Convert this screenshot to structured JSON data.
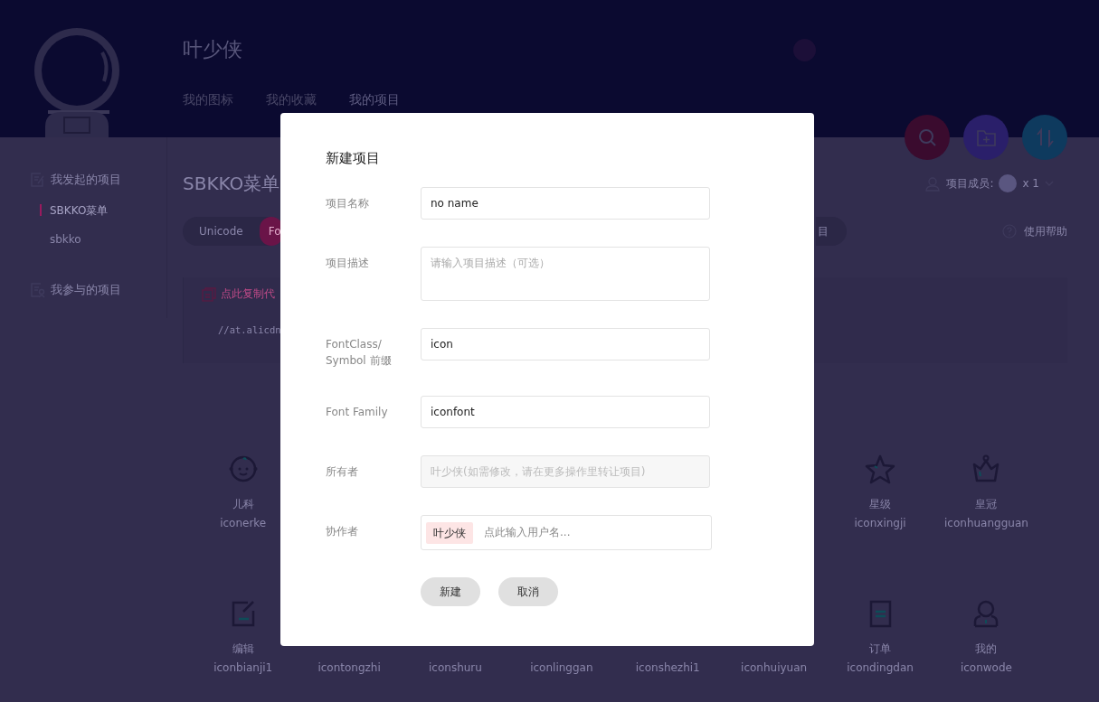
{
  "header": {
    "user_name": "叶少侠",
    "nav": [
      {
        "label": "我的图标",
        "selected": false
      },
      {
        "label": "我的收藏",
        "selected": false
      },
      {
        "label": "我的项目",
        "selected": true
      }
    ]
  },
  "sidebar": {
    "groups": [
      {
        "label": "我发起的项目",
        "items": [
          {
            "label": "SBKKO菜单",
            "selected": true
          },
          {
            "label": "sbkko",
            "selected": false
          }
        ]
      },
      {
        "label": "我参与的项目"
      }
    ]
  },
  "project": {
    "title": "SBKKO菜单",
    "members_label": "项目成员:",
    "members_count": "x 1",
    "help": "使用帮助",
    "tabs": [
      {
        "label": "Unicode",
        "selected": false
      },
      {
        "label": "Fo",
        "selected": true
      }
    ],
    "tab_right": {
      "label": "目",
      "selected": false
    },
    "copy_link": "点此复制代",
    "code": "//at.alicdn",
    "icon_rows": [
      [
        {
          "name": "儿科",
          "code": "iconerke",
          "kind": "baby"
        },
        {
          "name": "星级",
          "code": "iconxingji",
          "kind": "star"
        },
        {
          "name": "皇冠",
          "code": "iconhuangguan",
          "kind": "crown"
        }
      ],
      [
        {
          "name": "编辑",
          "code": "iconbianji1",
          "kind": "edit"
        },
        {
          "code": "icontongzhi"
        },
        {
          "code": "iconshuru"
        },
        {
          "code": "iconlinggan"
        },
        {
          "code": "iconshezhi1"
        },
        {
          "code": "iconhuiyuan"
        },
        {
          "name": "订单",
          "code": "icondingdan",
          "kind": "order"
        },
        {
          "name": "我的",
          "code": "iconwode",
          "kind": "user"
        }
      ]
    ]
  },
  "dialog": {
    "title": "新建项目",
    "fields": [
      {
        "label": "项目名称",
        "kind": "input",
        "value": "no name"
      },
      {
        "label": "项目描述",
        "kind": "textarea",
        "placeholder": "请输入项目描述（可选）"
      },
      {
        "label": "FontClass/ Symbol 前缀",
        "kind": "input",
        "value": "icon"
      },
      {
        "label": "Font Family",
        "kind": "input",
        "value": "iconfont"
      },
      {
        "label": "所有者",
        "kind": "disabled",
        "placeholder": "叶少侠(如需修改，请在更多操作里转让项目)"
      },
      {
        "label": "协作者",
        "kind": "tags",
        "tags": [
          "叶少侠"
        ],
        "placeholder": "点此输入用户名..."
      }
    ],
    "buttons": [
      "新建",
      "取消"
    ]
  }
}
